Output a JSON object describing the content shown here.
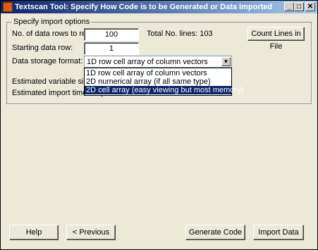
{
  "window": {
    "title": "Textscan Tool: Specify How Code is to be Generated or Data Imported",
    "minimize_glyph": "_",
    "maximize_glyph": "□",
    "close_glyph": "✕"
  },
  "import_options": {
    "legend": "Specify import options",
    "rows_label": "No. of data rows to read:",
    "rows_value": "100",
    "total_lines": "Total No. lines: 103",
    "count_button": "Count Lines in File",
    "start_label": "Starting data row:",
    "start_value": "1",
    "format_label": "Data storage format:",
    "format_value": "1D row cell array of column vectors",
    "format_options": [
      "1D row cell array of column vectors",
      "2D numerical array (if all same type)",
      "2D cell array (easy viewing but most memory)"
    ],
    "selected_option_index": 2,
    "size_label": "Estimated variable size: 47",
    "time_label": "Estimated import time: <1(s"
  },
  "buttons": {
    "help": "Help",
    "previous": "< Previous",
    "generate": "Generate Code",
    "import": "Import Data"
  }
}
